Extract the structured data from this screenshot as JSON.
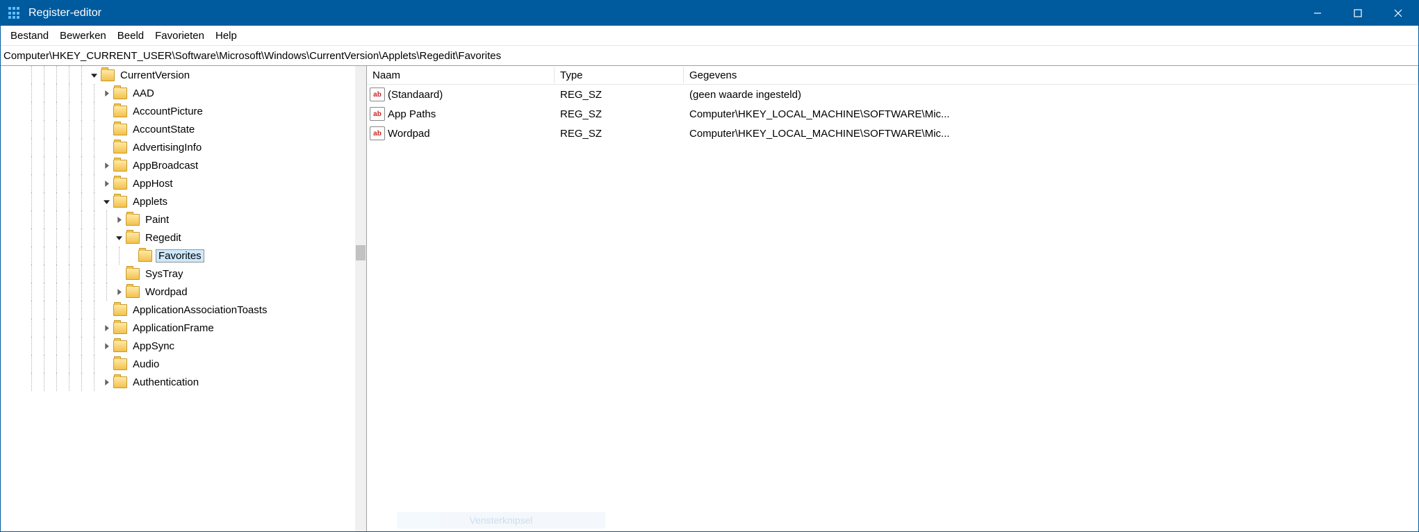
{
  "window": {
    "title": "Register-editor"
  },
  "menu": {
    "file": "Bestand",
    "edit": "Bewerken",
    "view": "Beeld",
    "favorites": "Favorieten",
    "help": "Help"
  },
  "address": {
    "path": "Computer\\HKEY_CURRENT_USER\\Software\\Microsoft\\Windows\\CurrentVersion\\Applets\\Regedit\\Favorites"
  },
  "tree": [
    {
      "depth": 7,
      "expander": "open",
      "label": "CurrentVersion",
      "selected": false
    },
    {
      "depth": 8,
      "expander": "closed",
      "label": "AAD"
    },
    {
      "depth": 8,
      "expander": "none",
      "label": "AccountPicture"
    },
    {
      "depth": 8,
      "expander": "none",
      "label": "AccountState"
    },
    {
      "depth": 8,
      "expander": "none",
      "label": "AdvertisingInfo"
    },
    {
      "depth": 8,
      "expander": "closed",
      "label": "AppBroadcast"
    },
    {
      "depth": 8,
      "expander": "closed",
      "label": "AppHost"
    },
    {
      "depth": 8,
      "expander": "open",
      "label": "Applets"
    },
    {
      "depth": 9,
      "expander": "closed",
      "label": "Paint"
    },
    {
      "depth": 9,
      "expander": "open",
      "label": "Regedit"
    },
    {
      "depth": 10,
      "expander": "none",
      "label": "Favorites",
      "selected": true
    },
    {
      "depth": 9,
      "expander": "none",
      "label": "SysTray"
    },
    {
      "depth": 9,
      "expander": "closed",
      "label": "Wordpad"
    },
    {
      "depth": 8,
      "expander": "none",
      "label": "ApplicationAssociationToasts"
    },
    {
      "depth": 8,
      "expander": "closed",
      "label": "ApplicationFrame"
    },
    {
      "depth": 8,
      "expander": "closed",
      "label": "AppSync"
    },
    {
      "depth": 8,
      "expander": "none",
      "label": "Audio"
    },
    {
      "depth": 8,
      "expander": "closed",
      "label": "Authentication"
    }
  ],
  "columns": {
    "name": "Naam",
    "type": "Type",
    "data": "Gegevens"
  },
  "values": [
    {
      "name": "(Standaard)",
      "type": "REG_SZ",
      "data": "(geen waarde ingesteld)"
    },
    {
      "name": "App Paths",
      "type": "REG_SZ",
      "data": "Computer\\HKEY_LOCAL_MACHINE\\SOFTWARE\\Mic..."
    },
    {
      "name": "Wordpad",
      "type": "REG_SZ",
      "data": "Computer\\HKEY_LOCAL_MACHINE\\SOFTWARE\\Mic..."
    }
  ],
  "watermark": "Vensterknipsel"
}
